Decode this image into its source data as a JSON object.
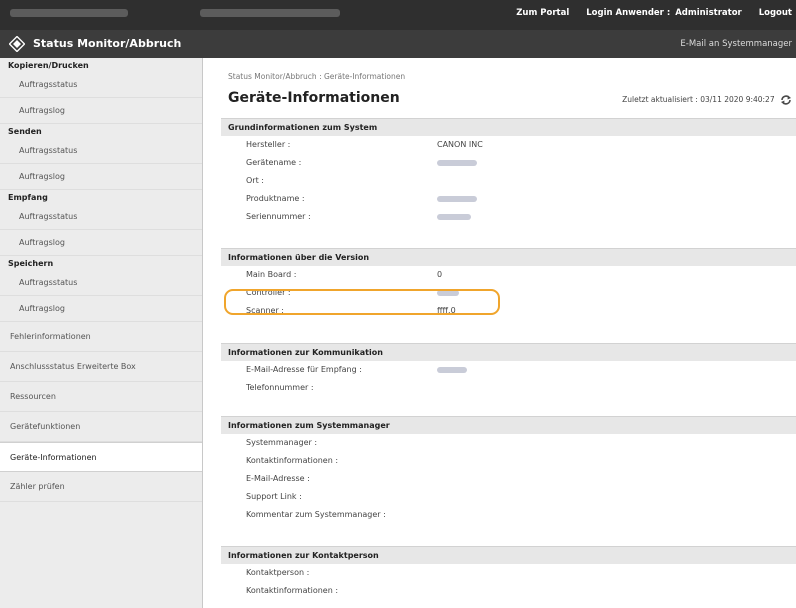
{
  "topbar": {
    "portal_link": "Zum Portal",
    "login_label": "Login Anwender :",
    "user": "Administrator",
    "logout": "Logout"
  },
  "titlebar": {
    "app_title": "Status Monitor/Abbruch",
    "email_link": "E-Mail an Systemmanager"
  },
  "sidebar": {
    "groups": [
      {
        "heading": "Kopieren/Drucken",
        "items": [
          "Auftragsstatus",
          "Auftragslog"
        ]
      },
      {
        "heading": "Senden",
        "items": [
          "Auftragsstatus",
          "Auftragslog"
        ]
      },
      {
        "heading": "Empfang",
        "items": [
          "Auftragsstatus",
          "Auftragslog"
        ]
      },
      {
        "heading": "Speichern",
        "items": [
          "Auftragsstatus",
          "Auftragslog"
        ]
      }
    ],
    "plain_items": [
      "Fehlerinformationen",
      "Anschlussstatus Erweiterte Box",
      "Ressourcen",
      "Gerätefunktionen",
      "Geräte-Informationen",
      "Zähler prüfen"
    ],
    "active_item": "Geräte-Informationen"
  },
  "main": {
    "breadcrumb": "Status Monitor/Abbruch : Geräte-Informationen",
    "page_title": "Geräte-Informationen",
    "updated": "Zuletzt aktualisiert : 03/11 2020 9:40:27",
    "sections": {
      "system": {
        "title": "Grundinformationen zum System",
        "rows": {
          "manufacturer_label": "Hersteller :",
          "manufacturer_value": "CANON INC",
          "device_name_label": "Gerätename :",
          "location_label": "Ort :",
          "product_name_label": "Produktname :",
          "serial_label": "Seriennummer :"
        }
      },
      "version": {
        "title": "Informationen über die Version",
        "rows": {
          "main_board_label": "Main Board :",
          "main_board_value": "0",
          "controller_label": "Controller :",
          "scanner_label": "Scanner :",
          "scanner_value": "ffff.0"
        }
      },
      "communication": {
        "title": "Informationen zur Kommunikation",
        "rows": {
          "email_label": "E-Mail-Adresse für Empfang :",
          "phone_label": "Telefonnummer :"
        }
      },
      "sysmanager": {
        "title": "Informationen zum Systemmanager",
        "rows": {
          "manager_label": "Systemmanager :",
          "contact_label": "Kontaktinformationen :",
          "email_label": "E-Mail-Adresse :",
          "support_label": "Support Link :",
          "comment_label": "Kommentar zum Systemmanager :"
        }
      },
      "contact": {
        "title": "Informationen zur Kontaktperson",
        "rows": {
          "person_label": "Kontaktperson :",
          "contact_label": "Kontaktinformationen :"
        }
      }
    }
  },
  "colors": {
    "topbar": "#2f2f2f",
    "titlebar": "#3c3c3c",
    "sidebar": "#ececec",
    "section_header": "#e7e7e7",
    "highlight": "#f0a52c",
    "refresh_icon": "#4a4a4a"
  }
}
